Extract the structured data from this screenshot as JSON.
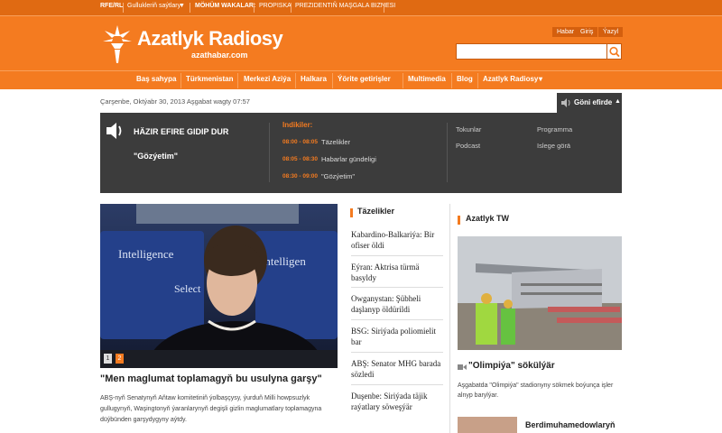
{
  "utility": {
    "rferl": "RFE/RL",
    "services": "Gullukleriň saýtlary",
    "important": "MÖHÜM WAKALAR:",
    "link1": "PROPISKA",
    "link2": "PREZIDENTIŇ MAŞGALA BIZNESI"
  },
  "brand": {
    "title": "Azatlyk Radiosy",
    "url": "azathabar.com"
  },
  "lang": [
    "Habar",
    "Giriş",
    "Ýazyl"
  ],
  "search": {
    "placeholder": ""
  },
  "nav": [
    "Baş sahypa",
    "Türkmenistan",
    "Merkezi Aziýa",
    "Halkara",
    "Ýörite getirişler",
    "Multimedia",
    "Blog",
    "Azatlyk Radiosy"
  ],
  "date": "Çarşenbe, Oktýabr 30, 2013 Aşgabat wagty 07:57",
  "live": {
    "tab": "Göni efirde",
    "now_label": "HÄZIR EFIRE GIDIP DUR",
    "now_program": "\"Gözýetim\"",
    "schedule_head": "Indikiler:",
    "schedule": [
      {
        "time": "08:00 - 08:05",
        "title": "Täzelikler"
      },
      {
        "time": "08:05 - 08:30",
        "title": "Habarlar gündeligi"
      },
      {
        "time": "08:30 - 09:00",
        "title": "\"Gözýetim\""
      }
    ],
    "links": [
      "Tokunlar",
      "Podcast",
      "Programma",
      "Islege görä"
    ]
  },
  "hero": {
    "slides": [
      "1",
      "2"
    ],
    "title": "\"Men maglumat toplamagyň bu usulyna garşy\"",
    "text": "ABŞ-nyň Senatynyň Aňtaw komitetiniň ýolbaşçysy, ýurduň Milli howpsuzlyk gullugynyň, Waşingtonyň ýaranlarynyň degişli gizlin maglumatlary toplamagyna düýbünden garşydygyny aýtdy."
  },
  "news": {
    "head": "Täzelikler",
    "items": [
      "Kabardino-Balkariýa: Bir ofiser öldi",
      "Eýran: Aktrisa türmä basyldy",
      "Owganystan: Şübheli daşlanyp öldürildi",
      "BSG: Siriýada poliomielit bar",
      "ABŞ: Senator MHG barada sözledi",
      "Duşenbe: Siriýada täjik raýatlary söweşýär"
    ]
  },
  "tw": {
    "head": "Azatlyk TW",
    "title": "\"Olimpiýa\" sökülýär",
    "text": "Aşgabatda \"Olimpiýa\" stadionyny sökmek boýunça işler alnyp barylýar.",
    "next": "Berdimuhamedowlaryň"
  },
  "colors": {
    "accent": "#f47b20",
    "dark": "#3c3c3c"
  }
}
